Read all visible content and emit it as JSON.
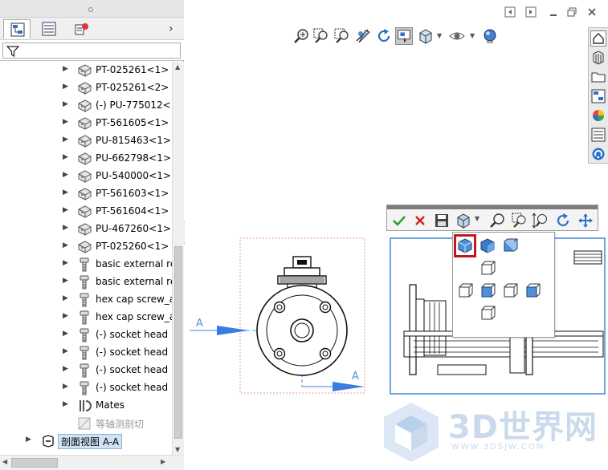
{
  "feature_tree": {
    "tabs": [
      {
        "name": "featuremanager-tab",
        "active": true
      },
      {
        "name": "propertymanager-tab",
        "active": false
      },
      {
        "name": "configurationmanager-tab",
        "active": false
      }
    ],
    "filter_icon": "funnel-icon",
    "items": [
      {
        "label": "PT-025261<1> (",
        "icon": "part-icon",
        "type": "part"
      },
      {
        "label": "PT-025261<2> (",
        "icon": "part-icon",
        "type": "part"
      },
      {
        "label": "(-) PU-775012<1",
        "icon": "part-icon",
        "type": "part"
      },
      {
        "label": "PT-561605<1> (",
        "icon": "part-icon",
        "type": "part"
      },
      {
        "label": "PU-815463<1>",
        "icon": "part-icon",
        "type": "part"
      },
      {
        "label": "PU-662798<1>",
        "icon": "part-icon",
        "type": "part"
      },
      {
        "label": "PU-540000<1>",
        "icon": "part-icon",
        "type": "part"
      },
      {
        "label": "PT-561603<1> -",
        "icon": "part-icon",
        "type": "part"
      },
      {
        "label": "PT-561604<1> (",
        "icon": "part-icon",
        "type": "part"
      },
      {
        "label": "PU-467260<1>",
        "icon": "part-icon",
        "type": "part"
      },
      {
        "label": "PT-025260<1> (",
        "icon": "part-icon",
        "type": "part"
      },
      {
        "label": "basic external re",
        "icon": "screw-icon",
        "type": "screw"
      },
      {
        "label": "basic external re",
        "icon": "screw-icon",
        "type": "screw"
      },
      {
        "label": "hex cap screw_a",
        "icon": "screw-icon",
        "type": "screw"
      },
      {
        "label": "hex cap screw_a",
        "icon": "screw-icon",
        "type": "screw"
      },
      {
        "label": "(-) socket head",
        "icon": "screw-icon",
        "type": "screw"
      },
      {
        "label": "(-) socket head",
        "icon": "screw-icon",
        "type": "screw"
      },
      {
        "label": "(-) socket head",
        "icon": "screw-icon",
        "type": "screw"
      },
      {
        "label": "(-) socket head",
        "icon": "screw-icon",
        "type": "screw"
      },
      {
        "label": "Mates",
        "icon": "mates-icon",
        "type": "mates"
      },
      {
        "label": "等轴测剖切",
        "icon": "section-icon",
        "type": "gray"
      }
    ],
    "section_view_item": {
      "label": "剖面视图 A-A",
      "icon": "section-view-icon"
    }
  },
  "graphics": {
    "section_labels": {
      "left": "A",
      "right": "A"
    },
    "heads_up_toolbar": [
      {
        "name": "zoom-to-fit-icon"
      },
      {
        "name": "zoom-to-area-icon"
      },
      {
        "name": "previous-view-icon"
      },
      {
        "name": "section-view-icon"
      },
      {
        "name": "rotate-view-icon"
      },
      {
        "name": "view-orientation-icon",
        "active": true
      },
      {
        "name": "display-style-icon"
      },
      {
        "name": "hide-show-items-icon"
      },
      {
        "name": "appearance-icon"
      }
    ],
    "task_pane": [
      {
        "name": "home-tab-icon"
      },
      {
        "name": "design-library-icon"
      },
      {
        "name": "file-explorer-icon"
      },
      {
        "name": "view-palette-icon"
      },
      {
        "name": "appearances-icon"
      },
      {
        "name": "custom-properties-icon"
      },
      {
        "name": "solidworks-forum-icon"
      }
    ],
    "popup_toolbar": {
      "buttons": [
        {
          "name": "ok-check-icon",
          "color": "#2f9e2f"
        },
        {
          "name": "cancel-x-icon",
          "color": "#d02020"
        },
        {
          "name": "save-view-icon"
        },
        {
          "name": "view-orientation-icon"
        },
        {
          "name": "zoom-to-fit-icon"
        },
        {
          "name": "zoom-to-area-icon"
        },
        {
          "name": "zoom-in-out-icon"
        },
        {
          "name": "rotate-icon"
        },
        {
          "name": "pan-icon"
        }
      ],
      "flyout_selected": "isometric-view"
    }
  },
  "watermark": {
    "text": "3D世界网",
    "url": "WWW.3DSJW.COM"
  },
  "colors": {
    "accent": "#4a90e2",
    "section_arrow": "#3a7de0",
    "highlight": "#c0181e"
  }
}
